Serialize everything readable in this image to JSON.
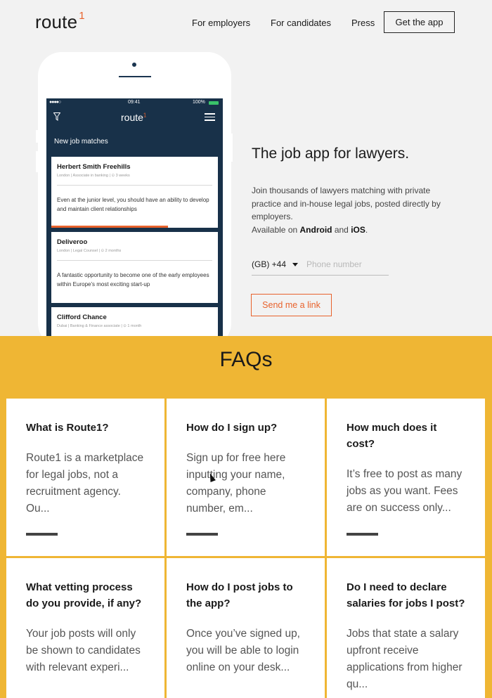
{
  "header": {
    "logo_text": "route",
    "logo_mark": "1",
    "nav": [
      "For employers",
      "For candidates",
      "Press"
    ],
    "cta_label": "Get the app"
  },
  "phone": {
    "status_signal": "●●●●○",
    "status_time": "09:41",
    "status_battery": "100%",
    "app_logo_text": "route",
    "app_logo_mark": "1",
    "section_title": "New job matches",
    "jobs": [
      {
        "company": "Herbert Smith Freehills",
        "meta": "London | Associate in banking | ⊙ 3 weeks",
        "desc": "Even at the junior level, you should have an ability to develop and maintain client relationships",
        "progress": 0.7
      },
      {
        "company": "Deliveroo",
        "meta": "London | Legal Counsel | ⊙ 2 months",
        "desc": "A fantastic opportunity to become one of the early employees within Europe's most exciting start-up"
      },
      {
        "company": "Clifford Chance",
        "meta": "Dubai | Banking & Finance associate | ⊙ 1 month",
        "desc": ""
      }
    ]
  },
  "hero": {
    "title": "The job app for lawyers.",
    "text": "Join thousands of lawyers matching with private practice and in-house legal jobs, posted directly by employers.",
    "available_prefix": "Available on ",
    "android": "Android",
    "and": " and ",
    "ios": "iOS",
    "period": ".",
    "country_code": "(GB) +44",
    "phone_placeholder": "Phone number",
    "send_label": "Send me a link"
  },
  "faq": {
    "title": "FAQs",
    "items": [
      {
        "q": "What is Route1?",
        "a": "Route1 is a marketplace for legal jobs, not a recruitment agency. Ou..."
      },
      {
        "q": "How do I sign up?",
        "a": "Sign up for free here inputting your name, company, phone number, em..."
      },
      {
        "q": "How much does it cost?",
        "a": "It’s free to post as many jobs as you want. Fees are on success only..."
      },
      {
        "q": "What vetting process do you provide, if any?",
        "a": "Your job posts will only be shown to candidates with relevant experi..."
      },
      {
        "q": "How do I post jobs to the app?",
        "a": "Once you’ve signed up, you will be able to login online on your desk..."
      },
      {
        "q": "Do I need to declare salaries for jobs I post?",
        "a": "Jobs that state a salary upfront receive applications from higher qu..."
      }
    ]
  },
  "colors": {
    "accent": "#e8622c",
    "faq_bg": "#efb634",
    "phone_screen": "#183149"
  }
}
